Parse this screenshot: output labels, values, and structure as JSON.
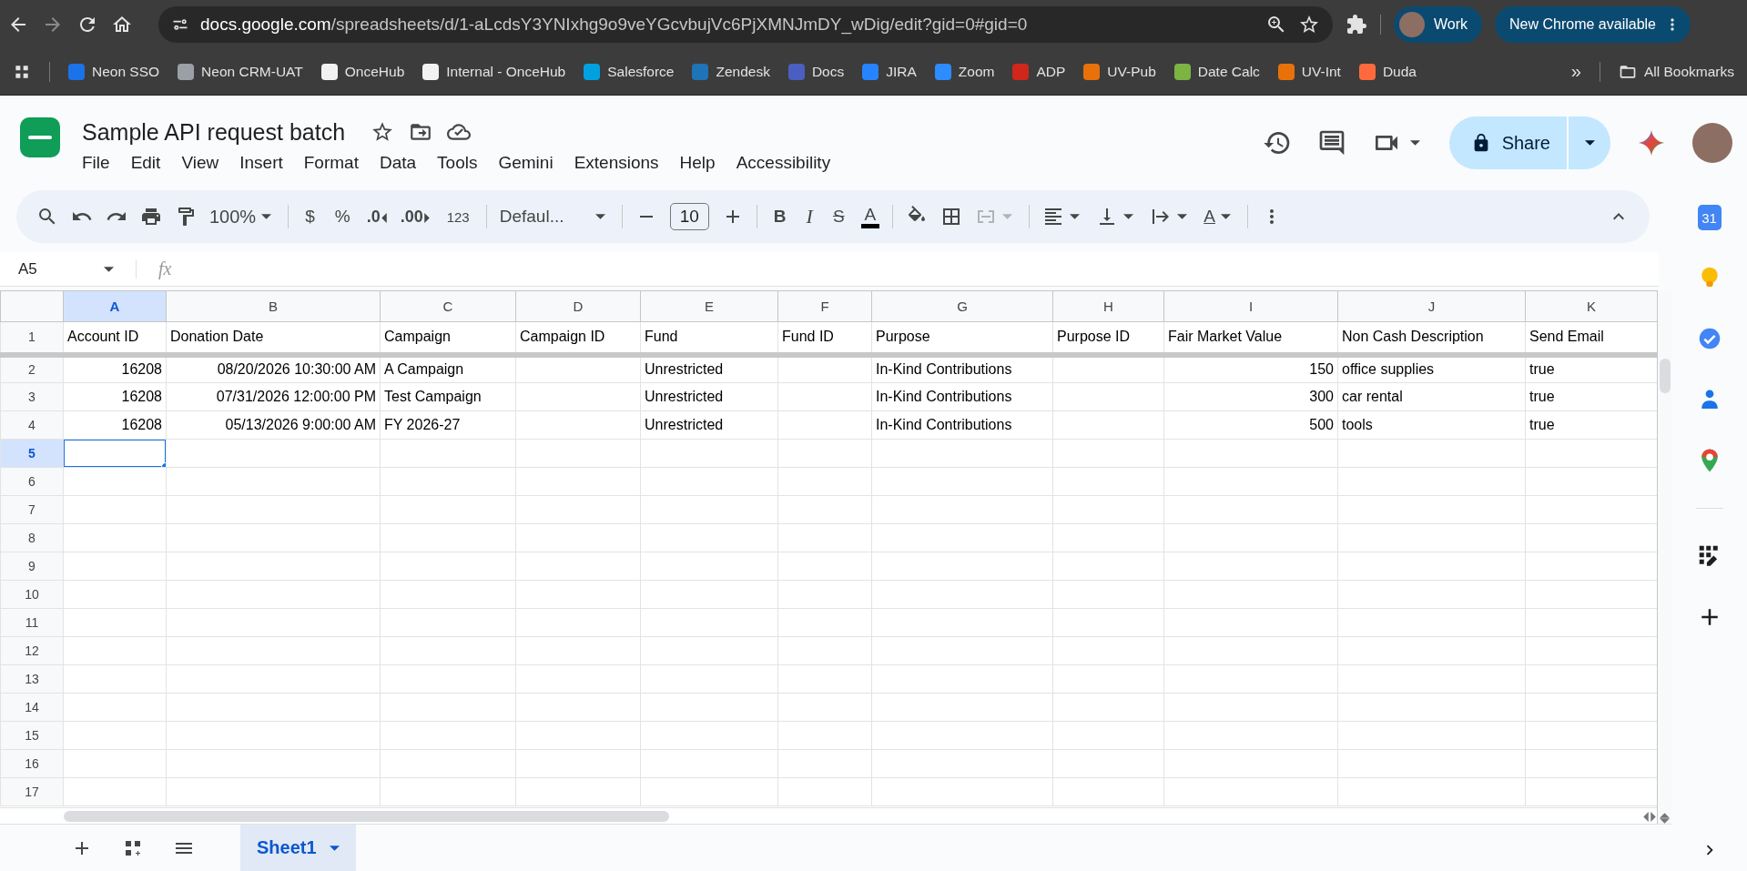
{
  "browser": {
    "url_host": "docs.google.com",
    "url_path": "/spreadsheets/d/1-aLcdsY3YNIxhg9o9veYGcvbujVc6PjXMNJmDY_wDig/edit?gid=0#gid=0",
    "profile": "Work",
    "update_button": "New Chrome available",
    "overflow": "»",
    "all_bookmarks": "All Bookmarks",
    "bookmarks": [
      {
        "label": "Neon SSO",
        "color": "#1a73e8"
      },
      {
        "label": "Neon CRM-UAT",
        "color": "#9aa0a6"
      },
      {
        "label": "OnceHub",
        "color": "#f2f2f2"
      },
      {
        "label": "Internal - OnceHub",
        "color": "#f2f2f2"
      },
      {
        "label": "Salesforce",
        "color": "#00a1e0"
      },
      {
        "label": "Zendesk",
        "color": "#1f73b7"
      },
      {
        "label": "Docs",
        "color": "#4a5fc1"
      },
      {
        "label": "JIRA",
        "color": "#2684ff"
      },
      {
        "label": "Zoom",
        "color": "#2d8cff"
      },
      {
        "label": "ADP",
        "color": "#d0271d"
      },
      {
        "label": "UV-Pub",
        "color": "#e8710a"
      },
      {
        "label": "Date Calc",
        "color": "#7cb342"
      },
      {
        "label": "UV-Int",
        "color": "#e8710a"
      },
      {
        "label": "Duda",
        "color": "#ff6a3d"
      }
    ]
  },
  "sheet": {
    "title": "Sample API request batch",
    "menu": [
      "File",
      "Edit",
      "View",
      "Insert",
      "Format",
      "Data",
      "Tools",
      "Gemini",
      "Extensions",
      "Help",
      "Accessibility"
    ],
    "share": "Share",
    "toolbar": {
      "zoom": "100%",
      "currency": "$",
      "percent": "%",
      "decrease_decimals": ".0",
      "increase_decimals": ".00",
      "more_formats": "123",
      "font": "Defaul...",
      "font_size": "10",
      "bold": "B",
      "italic": "I",
      "strikethrough": "S",
      "text_color": "A",
      "text_rotation": "A"
    },
    "name_box": "A5",
    "formula_label": "fx",
    "columns": [
      {
        "label": "A",
        "selected": true,
        "kind": "number"
      },
      {
        "label": "B",
        "selected": false,
        "kind": "number"
      },
      {
        "label": "C",
        "selected": false,
        "kind": "text"
      },
      {
        "label": "D",
        "selected": false,
        "kind": "text"
      },
      {
        "label": "E",
        "selected": false,
        "kind": "text"
      },
      {
        "label": "F",
        "selected": false,
        "kind": "text"
      },
      {
        "label": "G",
        "selected": false,
        "kind": "text"
      },
      {
        "label": "H",
        "selected": false,
        "kind": "text"
      },
      {
        "label": "I",
        "selected": false,
        "kind": "number"
      },
      {
        "label": "J",
        "selected": false,
        "kind": "text"
      },
      {
        "label": "K",
        "selected": false,
        "kind": "text"
      }
    ],
    "rows": [
      {
        "number": "1",
        "selected": false,
        "frozen": true,
        "cells": [
          "Account ID",
          "Donation Date",
          "Campaign",
          "Campaign ID",
          "Fund",
          "Fund ID",
          "Purpose",
          "Purpose ID",
          "Fair Market Value",
          "Non Cash Description",
          "Send Email"
        ]
      },
      {
        "number": "2",
        "selected": false,
        "frozen": false,
        "cells": [
          "16208",
          "08/20/2026 10:30:00 AM",
          "A Campaign",
          null,
          "Unrestricted",
          null,
          "In-Kind Contributions",
          null,
          "150",
          "office supplies",
          "true"
        ]
      },
      {
        "number": "3",
        "selected": false,
        "frozen": false,
        "cells": [
          "16208",
          "07/31/2026 12:00:00 PM",
          "Test Campaign",
          null,
          "Unrestricted",
          null,
          "In-Kind Contributions",
          null,
          "300",
          "car rental",
          "true"
        ]
      },
      {
        "number": "4",
        "selected": false,
        "frozen": false,
        "cells": [
          "16208",
          "05/13/2026 9:00:00 AM",
          "FY 2026-27",
          null,
          "Unrestricted",
          null,
          "In-Kind Contributions",
          null,
          "500",
          "tools",
          "true"
        ]
      },
      {
        "number": "5",
        "selected": true,
        "frozen": false
      },
      {
        "number": "6",
        "selected": false,
        "frozen": false
      },
      {
        "number": "7",
        "selected": false,
        "frozen": false
      },
      {
        "number": "8",
        "selected": false,
        "frozen": false
      },
      {
        "number": "9",
        "selected": false,
        "frozen": false
      },
      {
        "number": "10",
        "selected": false,
        "frozen": false
      },
      {
        "number": "11",
        "selected": false,
        "frozen": false
      },
      {
        "number": "12",
        "selected": false,
        "frozen": false
      },
      {
        "number": "13",
        "selected": false,
        "frozen": false
      },
      {
        "number": "14",
        "selected": false,
        "frozen": false
      },
      {
        "number": "15",
        "selected": false,
        "frozen": false
      },
      {
        "number": "16",
        "selected": false,
        "frozen": false
      },
      {
        "number": "17",
        "selected": false,
        "frozen": false
      }
    ],
    "sheet_tabs": [
      {
        "label": "Sheet1",
        "selected": true
      }
    ],
    "side_panel": {
      "calendar_day": "31"
    }
  }
}
